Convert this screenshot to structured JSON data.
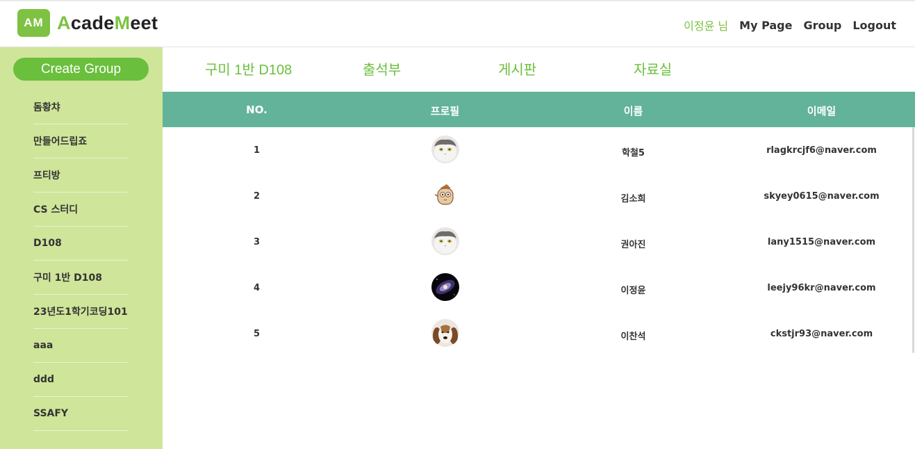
{
  "brand": {
    "badge": "AM",
    "name_a": "A",
    "name_b": "cade",
    "name_c": "M",
    "name_d": "eet"
  },
  "topnav": {
    "user": "이정윤 님",
    "mypage": "My Page",
    "group": "Group",
    "logout": "Logout"
  },
  "sidebar": {
    "create_label": "Create Group",
    "groups": [
      "돔황챠",
      "만들어드립죠",
      "프티방",
      "CS 스터디",
      "D108",
      "구미 1반 D108",
      "23년도1학기코딩101",
      "aaa",
      "ddd",
      "SSAFY"
    ]
  },
  "tabs": [
    "구미 1반 D108",
    "출석부",
    "게시판",
    "자료실"
  ],
  "table": {
    "headers": [
      "NO.",
      "프로필",
      "이름",
      "이메일"
    ],
    "rows": [
      {
        "no": "1",
        "avatar": "cat-avatar",
        "name": "학철5",
        "email": "rlagkrcjf6@naver.com"
      },
      {
        "no": "2",
        "avatar": "owl-avatar",
        "name": "김소희",
        "email": "skyey0615@naver.com"
      },
      {
        "no": "3",
        "avatar": "cat-avatar",
        "name": "권아진",
        "email": "lany1515@naver.com"
      },
      {
        "no": "4",
        "avatar": "galaxy-avatar",
        "name": "이정윤",
        "email": "leejy96kr@naver.com"
      },
      {
        "no": "5",
        "avatar": "dog-avatar",
        "name": "이찬석",
        "email": "ckstjr93@naver.com"
      }
    ]
  },
  "colors": {
    "accent": "#6abf3c",
    "sidebar_bg": "#cfe59a",
    "table_header": "#62b399"
  }
}
